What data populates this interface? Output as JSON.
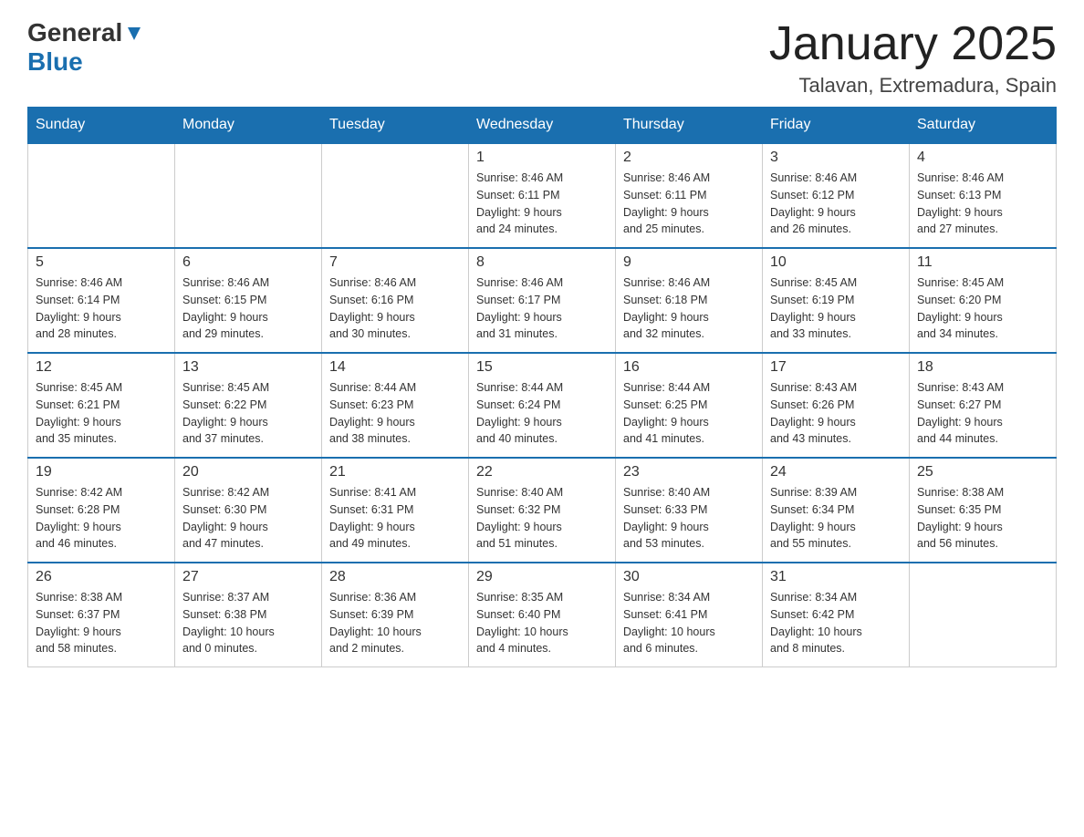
{
  "header": {
    "logo_general": "General",
    "logo_blue": "Blue",
    "title": "January 2025",
    "subtitle": "Talavan, Extremadura, Spain"
  },
  "days_of_week": [
    "Sunday",
    "Monday",
    "Tuesday",
    "Wednesday",
    "Thursday",
    "Friday",
    "Saturday"
  ],
  "weeks": [
    [
      {
        "day": "",
        "info": ""
      },
      {
        "day": "",
        "info": ""
      },
      {
        "day": "",
        "info": ""
      },
      {
        "day": "1",
        "info": "Sunrise: 8:46 AM\nSunset: 6:11 PM\nDaylight: 9 hours\nand 24 minutes."
      },
      {
        "day": "2",
        "info": "Sunrise: 8:46 AM\nSunset: 6:11 PM\nDaylight: 9 hours\nand 25 minutes."
      },
      {
        "day": "3",
        "info": "Sunrise: 8:46 AM\nSunset: 6:12 PM\nDaylight: 9 hours\nand 26 minutes."
      },
      {
        "day": "4",
        "info": "Sunrise: 8:46 AM\nSunset: 6:13 PM\nDaylight: 9 hours\nand 27 minutes."
      }
    ],
    [
      {
        "day": "5",
        "info": "Sunrise: 8:46 AM\nSunset: 6:14 PM\nDaylight: 9 hours\nand 28 minutes."
      },
      {
        "day": "6",
        "info": "Sunrise: 8:46 AM\nSunset: 6:15 PM\nDaylight: 9 hours\nand 29 minutes."
      },
      {
        "day": "7",
        "info": "Sunrise: 8:46 AM\nSunset: 6:16 PM\nDaylight: 9 hours\nand 30 minutes."
      },
      {
        "day": "8",
        "info": "Sunrise: 8:46 AM\nSunset: 6:17 PM\nDaylight: 9 hours\nand 31 minutes."
      },
      {
        "day": "9",
        "info": "Sunrise: 8:46 AM\nSunset: 6:18 PM\nDaylight: 9 hours\nand 32 minutes."
      },
      {
        "day": "10",
        "info": "Sunrise: 8:45 AM\nSunset: 6:19 PM\nDaylight: 9 hours\nand 33 minutes."
      },
      {
        "day": "11",
        "info": "Sunrise: 8:45 AM\nSunset: 6:20 PM\nDaylight: 9 hours\nand 34 minutes."
      }
    ],
    [
      {
        "day": "12",
        "info": "Sunrise: 8:45 AM\nSunset: 6:21 PM\nDaylight: 9 hours\nand 35 minutes."
      },
      {
        "day": "13",
        "info": "Sunrise: 8:45 AM\nSunset: 6:22 PM\nDaylight: 9 hours\nand 37 minutes."
      },
      {
        "day": "14",
        "info": "Sunrise: 8:44 AM\nSunset: 6:23 PM\nDaylight: 9 hours\nand 38 minutes."
      },
      {
        "day": "15",
        "info": "Sunrise: 8:44 AM\nSunset: 6:24 PM\nDaylight: 9 hours\nand 40 minutes."
      },
      {
        "day": "16",
        "info": "Sunrise: 8:44 AM\nSunset: 6:25 PM\nDaylight: 9 hours\nand 41 minutes."
      },
      {
        "day": "17",
        "info": "Sunrise: 8:43 AM\nSunset: 6:26 PM\nDaylight: 9 hours\nand 43 minutes."
      },
      {
        "day": "18",
        "info": "Sunrise: 8:43 AM\nSunset: 6:27 PM\nDaylight: 9 hours\nand 44 minutes."
      }
    ],
    [
      {
        "day": "19",
        "info": "Sunrise: 8:42 AM\nSunset: 6:28 PM\nDaylight: 9 hours\nand 46 minutes."
      },
      {
        "day": "20",
        "info": "Sunrise: 8:42 AM\nSunset: 6:30 PM\nDaylight: 9 hours\nand 47 minutes."
      },
      {
        "day": "21",
        "info": "Sunrise: 8:41 AM\nSunset: 6:31 PM\nDaylight: 9 hours\nand 49 minutes."
      },
      {
        "day": "22",
        "info": "Sunrise: 8:40 AM\nSunset: 6:32 PM\nDaylight: 9 hours\nand 51 minutes."
      },
      {
        "day": "23",
        "info": "Sunrise: 8:40 AM\nSunset: 6:33 PM\nDaylight: 9 hours\nand 53 minutes."
      },
      {
        "day": "24",
        "info": "Sunrise: 8:39 AM\nSunset: 6:34 PM\nDaylight: 9 hours\nand 55 minutes."
      },
      {
        "day": "25",
        "info": "Sunrise: 8:38 AM\nSunset: 6:35 PM\nDaylight: 9 hours\nand 56 minutes."
      }
    ],
    [
      {
        "day": "26",
        "info": "Sunrise: 8:38 AM\nSunset: 6:37 PM\nDaylight: 9 hours\nand 58 minutes."
      },
      {
        "day": "27",
        "info": "Sunrise: 8:37 AM\nSunset: 6:38 PM\nDaylight: 10 hours\nand 0 minutes."
      },
      {
        "day": "28",
        "info": "Sunrise: 8:36 AM\nSunset: 6:39 PM\nDaylight: 10 hours\nand 2 minutes."
      },
      {
        "day": "29",
        "info": "Sunrise: 8:35 AM\nSunset: 6:40 PM\nDaylight: 10 hours\nand 4 minutes."
      },
      {
        "day": "30",
        "info": "Sunrise: 8:34 AM\nSunset: 6:41 PM\nDaylight: 10 hours\nand 6 minutes."
      },
      {
        "day": "31",
        "info": "Sunrise: 8:34 AM\nSunset: 6:42 PM\nDaylight: 10 hours\nand 8 minutes."
      },
      {
        "day": "",
        "info": ""
      }
    ]
  ]
}
